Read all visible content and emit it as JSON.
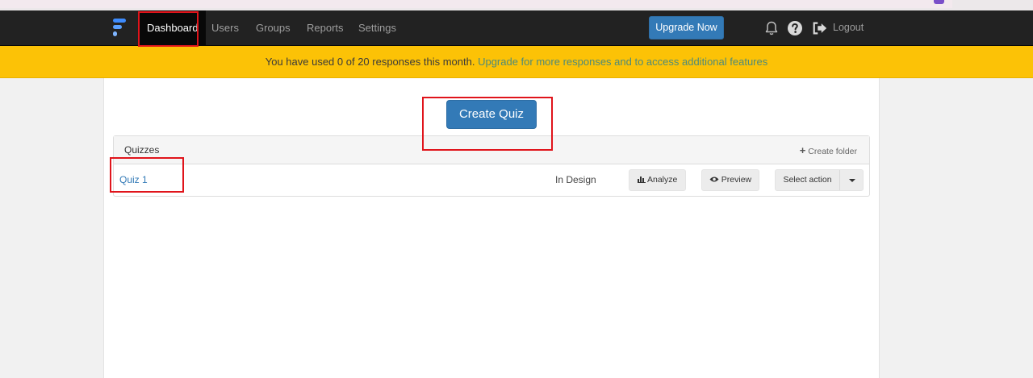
{
  "nav": {
    "items": [
      {
        "label": "Dashboard",
        "active": true
      },
      {
        "label": "Users",
        "active": false
      },
      {
        "label": "Groups",
        "active": false
      },
      {
        "label": "Reports",
        "active": false
      },
      {
        "label": "Settings",
        "active": false
      }
    ],
    "upgrade_label": "Upgrade Now",
    "logout_label": "Logout",
    "icons": [
      "bell-icon",
      "help-icon",
      "logout-icon"
    ],
    "logo_icon": "brand-logo-icon"
  },
  "banner": {
    "text": "You have used 0 of 20 responses this month.",
    "link_text": "Upgrade for more responses and to access additional features"
  },
  "main": {
    "create_quiz_label": "Create Quiz",
    "table": {
      "header": "Quizzes",
      "create_folder_label": "Create folder",
      "rows": [
        {
          "name": "Quiz 1",
          "status": "In Design",
          "analyze_label": "Analyze",
          "preview_label": "Preview",
          "select_action_label": "Select action"
        }
      ]
    }
  },
  "colors": {
    "navbar": "#222222",
    "banner": "#fcc206",
    "primary": "#337ab7",
    "highlight": "#e0141b"
  }
}
